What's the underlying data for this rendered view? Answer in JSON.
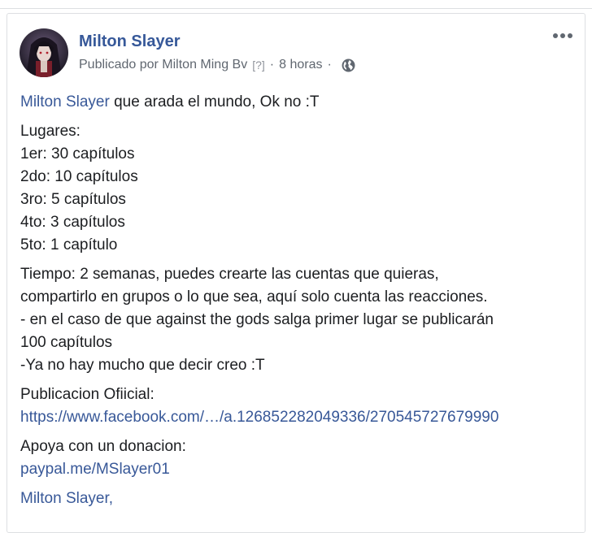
{
  "post": {
    "author": "Milton Slayer",
    "meta": {
      "published_by": "Publicado por Milton Ming Bv",
      "help_marker": "[?]",
      "time": "8 horas",
      "separator": "·"
    },
    "intro": {
      "mention": "Milton Slayer",
      "text": " que arada el mundo, Ok no :T"
    },
    "places": {
      "heading": "Lugares:",
      "items": [
        "1er: 30 capítulos",
        "2do: 10 capítulos",
        "3ro: 5 capítulos",
        "4to: 3 capítulos",
        "5to: 1 capítulo"
      ]
    },
    "details": [
      "Tiempo: 2 semanas, puedes crearte las cuentas que quieras,",
      "compartirlo en grupos o lo que sea, aquí solo cuenta las reacciones.",
      "- en el caso de que against the gods salga primer lugar se publicarán",
      "100 capítulos",
      "-Ya no hay mucho que decir creo :T"
    ],
    "official": {
      "label": "Publicacion Ofiicial:",
      "link": "https://www.facebook.com/…/a.126852282049336/270545727679990"
    },
    "donation": {
      "label": "Apoya con un donacion:",
      "link": "paypal.me/MSlayer01"
    },
    "signature": "Milton Slayer,"
  },
  "colors": {
    "link": "#385898",
    "name": "#365899",
    "meta": "#606770",
    "text": "#1c1e21"
  },
  "icons": {
    "more": "more-options-icon",
    "audience": "globe-icon"
  }
}
